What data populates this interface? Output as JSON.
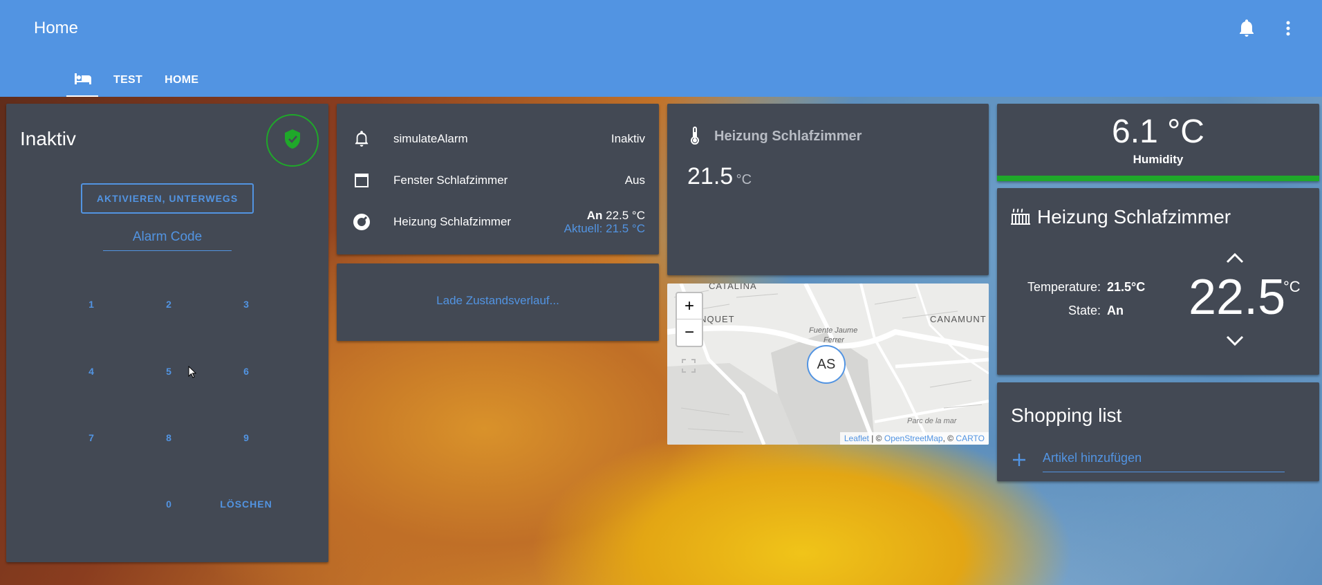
{
  "header": {
    "title": "Home",
    "icons": [
      "bell-icon",
      "more-vert-icon"
    ]
  },
  "tabs": [
    {
      "icon": "bed-icon",
      "label": ""
    },
    {
      "label": "TEST"
    },
    {
      "label": "HOME"
    }
  ],
  "alarm_panel": {
    "state": "Inaktiv",
    "arm_button": "AKTIVIEREN, UNTERWEGS",
    "code_placeholder": "Alarm Code",
    "keys": [
      "1",
      "2",
      "3",
      "4",
      "5",
      "6",
      "7",
      "8",
      "9",
      "0"
    ],
    "clear_label": "LÖSCHEN",
    "status_color": "#1fa82a"
  },
  "entities": [
    {
      "icon": "bell-outline-icon",
      "name": "simulateAlarm",
      "state": "Inaktiv"
    },
    {
      "icon": "window-icon",
      "name": "Fenster Schlafzimmer",
      "state": "Aus"
    },
    {
      "icon": "thermostat-icon",
      "name": "Heizung Schlafzimmer",
      "state_bold": "An",
      "state_temp": "22.5 °C",
      "state_current": "Aktuell: 21.5 °C"
    }
  ],
  "history": {
    "loading_text": "Lade Zustandsverlauf..."
  },
  "sensor_card": {
    "name": "Heizung Schlafzimmer",
    "value": "21.5",
    "unit": "°C"
  },
  "map": {
    "zoom_in": "+",
    "zoom_out": "−",
    "marker": "AS",
    "labels": [
      "CATALINA",
      "ONQUET",
      "Fuente Jaume",
      "Ferrer",
      "CANAMUNT",
      "Parc de la mar"
    ],
    "attribution": {
      "leaflet": "Leaflet",
      "sep1": " | © ",
      "osm": "OpenStreetMap",
      "sep2": ", © ",
      "carto": "CARTO"
    }
  },
  "gauge": {
    "value": "6.1 °C",
    "name": "Humidity",
    "bar_color": "#1fa82a"
  },
  "thermostat": {
    "name": "Heizung Schlafzimmer",
    "temperature_label": "Temperature:",
    "temperature_value": "21.5°C",
    "state_label": "State:",
    "state_value": "An",
    "target": "22.5",
    "unit": "°C"
  },
  "shopping": {
    "title": "Shopping list",
    "placeholder": "Artikel hinzufügen"
  }
}
